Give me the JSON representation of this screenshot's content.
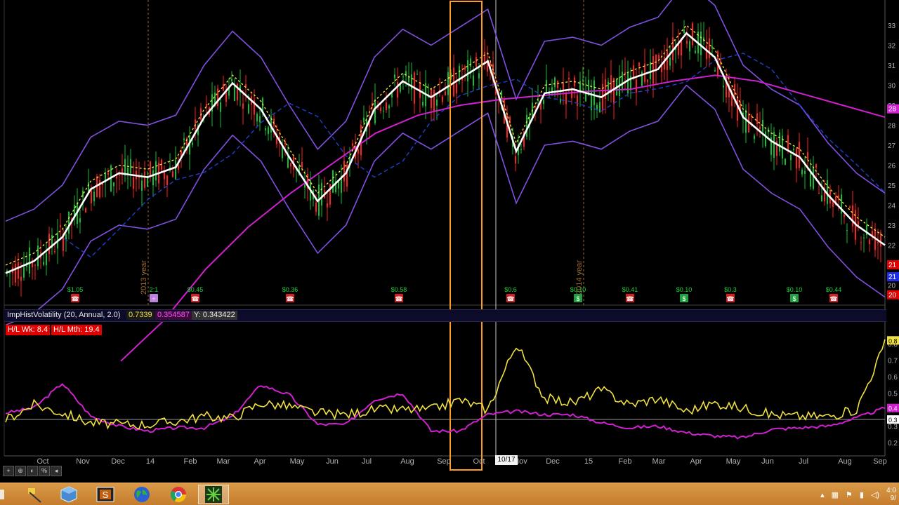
{
  "study": {
    "name": "ImpHistVolatility (20, Annual, 2.0)",
    "value1": "0.7339",
    "value2": "0.354587",
    "cursor": "Y: 0.343422"
  },
  "badges": {
    "week": "H/L Wk: 8.4",
    "month": "H/L Mth: 19.4"
  },
  "cursor_date": "10/17",
  "toolbar": [
    "+",
    "⊕",
    "◐",
    "%",
    "◂"
  ],
  "markers": [
    {
      "label": "$1.05",
      "icon": "phone-event-icon"
    },
    {
      "label": "2:1",
      "icon": "split-event-icon"
    },
    {
      "label": "$0.45",
      "icon": "phone-event-icon"
    },
    {
      "label": "$0.36",
      "icon": "phone-event-icon"
    },
    {
      "label": "$0.58",
      "icon": "phone-event-icon"
    },
    {
      "label": "$0.6",
      "icon": "phone-event-icon"
    },
    {
      "label": "$0.10",
      "icon": "dividend-event-icon"
    },
    {
      "label": "$0.41",
      "icon": "phone-event-icon"
    },
    {
      "label": "$0.10",
      "icon": "dividend-event-icon"
    },
    {
      "label": "$0.3",
      "icon": "phone-event-icon"
    },
    {
      "label": "$0.10",
      "icon": "dividend-event-icon"
    },
    {
      "label": "$0.44",
      "icon": "phone-event-icon"
    }
  ],
  "year_labels": [
    "2013 year",
    "2014 year"
  ],
  "chart_data": [
    {
      "type": "line",
      "title": "",
      "price_axis": [
        "33",
        "32",
        "31",
        "30",
        "29",
        "28",
        "27",
        "26",
        "25",
        "24",
        "23",
        "22",
        "21",
        "20"
      ],
      "months": [
        "Oct",
        "Nov",
        "Dec",
        "14",
        "Feb",
        "Mar",
        "Apr",
        "May",
        "Jun",
        "Jul",
        "Aug",
        "Sep",
        "Oct",
        "Nov",
        "Dec",
        "15",
        "Feb",
        "Mar",
        "Apr",
        "May",
        "Jun",
        "Jul",
        "Aug",
        "Sep"
      ],
      "price_tags": [
        {
          "text": "28",
          "color": "#d020d0"
        },
        {
          "text": "21",
          "color": "#e00000"
        },
        {
          "text": "21",
          "color": "#2030e0"
        },
        {
          "text": "20",
          "color": "#e00000"
        }
      ],
      "series": [
        {
          "name": "",
          "color": "#ffffff",
          "values": [
            20.6,
            21.2,
            22.4,
            24.8,
            25.6,
            25.4,
            25.9,
            28.4,
            30.1,
            28.8,
            26.4,
            24.2,
            25.6,
            28.8,
            30.2,
            29.4,
            30.3,
            31.2,
            26.7,
            29.6,
            29.8,
            29.4,
            30.3,
            30.8,
            32.6,
            31.4,
            28.4,
            27.2,
            26.4,
            24.5,
            23.0,
            22.0
          ]
        },
        {
          "name": "",
          "color": "#c000c0",
          "values": [
            16.2,
            18.2,
            20.8,
            22.9,
            24.6,
            26.1,
            27.6,
            28.5,
            29.0,
            29.3,
            29.5,
            29.7,
            29.8,
            30.2,
            30.5,
            30.2,
            29.6,
            29.0,
            28.4
          ]
        }
      ],
      "colors": {
        "up": "#10c030",
        "down": "#ff2020",
        "bands": "#8050e0",
        "ma_long": "#d020d0",
        "ma_mid": "#2040d0",
        "ma_fast": "#ffffff",
        "ma_dash": "#f0e040",
        "highlight": "#ff9a20"
      }
    },
    {
      "type": "line",
      "title": "",
      "vol_axis": [
        "0.8",
        "0.7",
        "0.6",
        "0.5",
        "0.4",
        "0.3",
        "0.2"
      ],
      "value_tags": [
        {
          "text": "0.8",
          "color": "#f0e040"
        },
        {
          "text": "0.4",
          "color": "#d020d0"
        },
        {
          "text": "0.3",
          "color": "#ffffff"
        }
      ],
      "series": [
        {
          "name": "",
          "color": "#f0e040",
          "values": [
            0.34,
            0.43,
            0.38,
            0.32,
            0.31,
            0.31,
            0.33,
            0.36,
            0.35,
            0.44,
            0.42,
            0.38,
            0.37,
            0.4,
            0.4,
            0.4,
            0.46,
            0.4,
            0.8,
            0.47,
            0.44,
            0.52,
            0.43,
            0.47,
            0.39,
            0.44,
            0.41,
            0.37,
            0.36,
            0.36,
            0.4,
            0.8
          ]
        },
        {
          "name": "",
          "color": "#d020d0",
          "values": [
            0.38,
            0.41,
            0.56,
            0.36,
            0.3,
            0.27,
            0.29,
            0.29,
            0.36,
            0.55,
            0.49,
            0.31,
            0.31,
            0.46,
            0.5,
            0.27,
            0.27,
            0.37,
            0.39,
            0.37,
            0.37,
            0.32,
            0.29,
            0.3,
            0.26,
            0.24,
            0.23,
            0.28,
            0.29,
            0.3,
            0.35,
            0.41
          ]
        }
      ]
    }
  ],
  "taskbar": [
    {
      "name": "taskbar-pen-tool",
      "icon": "pen-icon"
    },
    {
      "name": "taskbar-cube-app",
      "icon": "cube-icon"
    },
    {
      "name": "taskbar-s-app",
      "icon": "s-app-icon"
    },
    {
      "name": "taskbar-globe-app",
      "icon": "globe-icon"
    },
    {
      "name": "taskbar-chrome",
      "icon": "chrome-icon"
    },
    {
      "name": "taskbar-thinkorswim",
      "icon": "thinkorswim-icon"
    }
  ],
  "clock": {
    "time": "4:0",
    "date": "9/"
  }
}
